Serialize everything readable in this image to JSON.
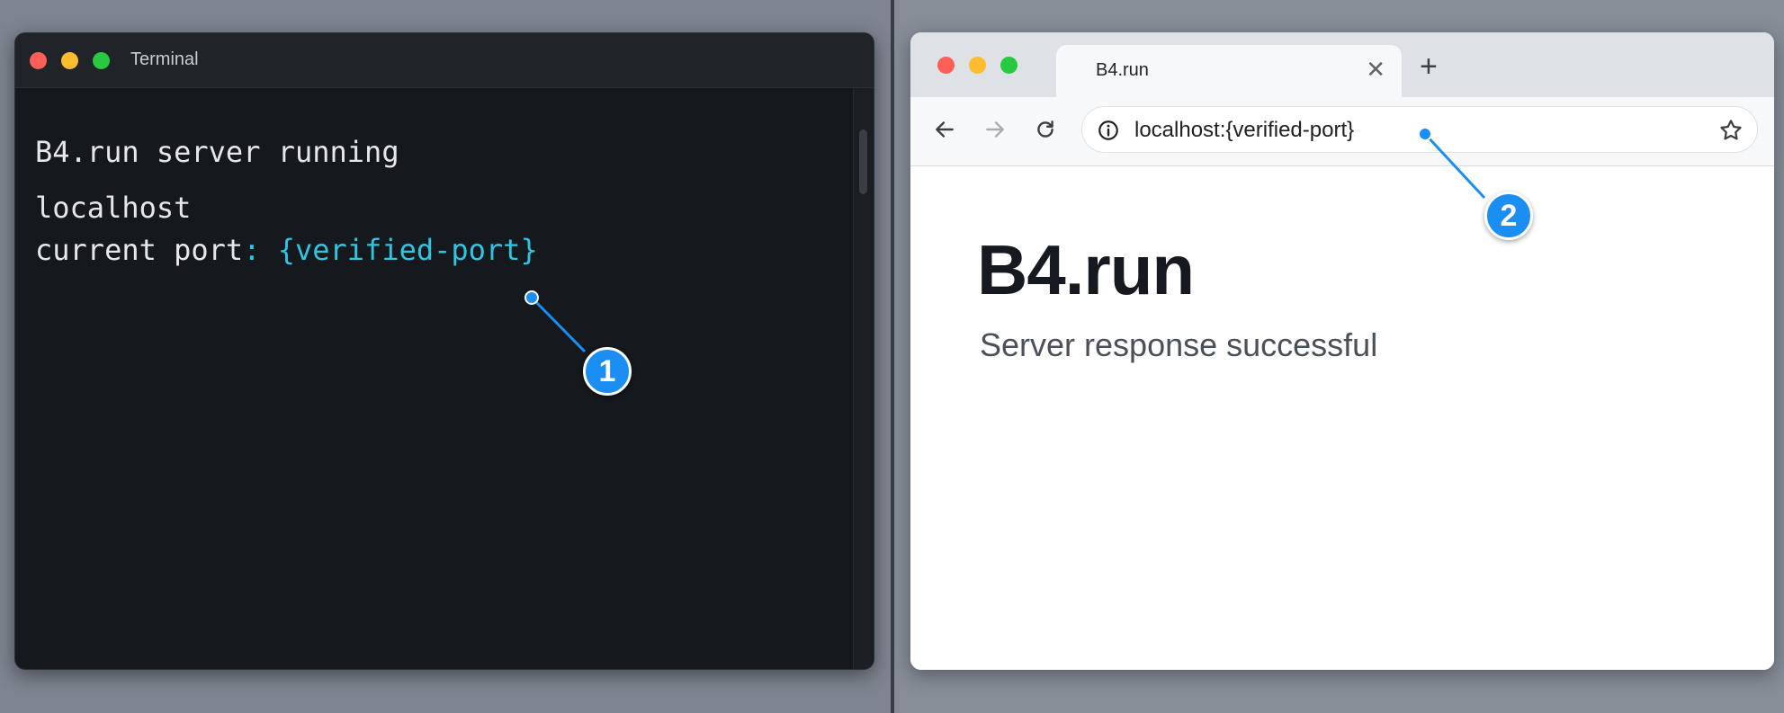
{
  "terminal": {
    "title": "Terminal",
    "lines": {
      "status": "B4.run server running",
      "host": "localhost",
      "port_label": "current port",
      "port_colon": ":",
      "port_value": "{verified-port}"
    }
  },
  "browser": {
    "tab_title": "B4.run",
    "tab_close": "✕",
    "new_tab": "+",
    "url": "localhost:{verified-port}",
    "page": {
      "heading": "B4.run",
      "subtitle": "Server response successful"
    }
  },
  "callouts": [
    {
      "number": "1"
    },
    {
      "number": "2"
    }
  ],
  "colors": {
    "accent": "#1a8ef2",
    "port_highlight": "#2fc4e0",
    "terminal_bg": "#15181c"
  },
  "icons": [
    "info-icon",
    "star-icon",
    "back-arrow-icon",
    "forward-arrow-icon",
    "reload-icon",
    "close-icon",
    "plus-icon"
  ]
}
